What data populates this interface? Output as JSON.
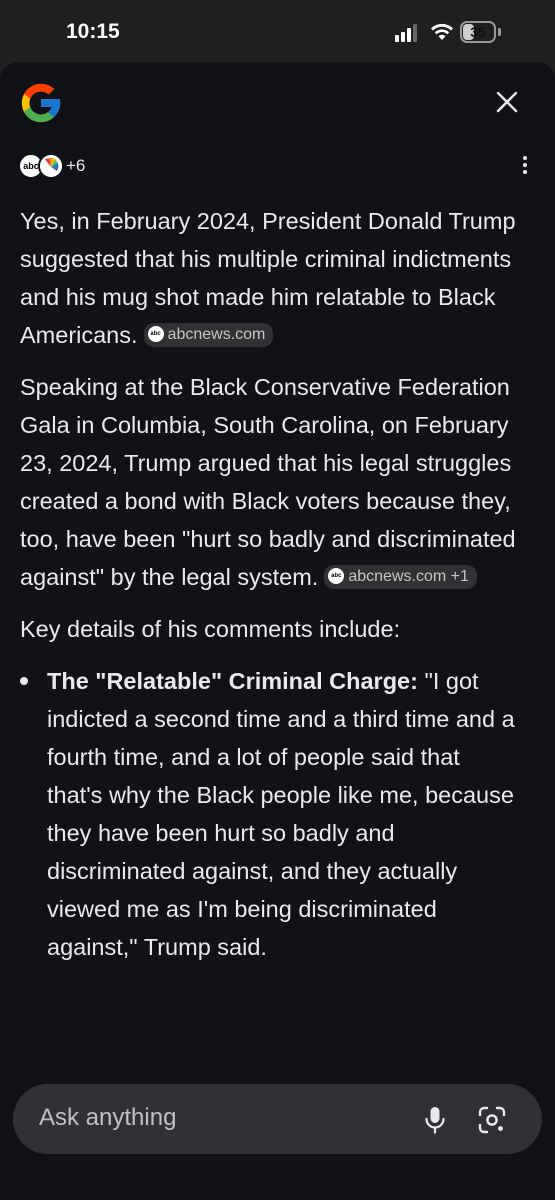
{
  "status_bar": {
    "time": "10:15",
    "battery_level": "35",
    "battery_fraction": 0.35
  },
  "header": {
    "logo_icon": "google-g-logo",
    "close_icon": "close-icon"
  },
  "sources": {
    "logos": [
      "abc-logo",
      "nbc-logo"
    ],
    "abc_text": "abc",
    "more_count": "+6",
    "menu_icon": "more-vert-icon"
  },
  "content": {
    "para1": "Yes, in February 2024, President Donald Trump suggested that his multiple criminal indictments and his mug shot made him relatable to Black Americans.",
    "para1_chip": "abcnews.com",
    "para2": "Speaking at the Black Conservative Federation Gala in Columbia, South Carolina, on February 23, 2024, Trump argued that his legal struggles created a bond with Black voters because they, too, have been \"hurt so badly and discriminated against\" by the legal system.",
    "para2_chip": "abcnews.com +1",
    "para3": "Key details of his comments include:",
    "bullets": [
      {
        "title": "The \"Relatable\" Criminal Charge:",
        "text": " \"I got indicted a second time and a third time and a fourth time, and a lot of people said that that's why the Black people like me, because they have been hurt so badly and discriminated against, and they actually viewed me as I'm being discriminated against,\" Trump said."
      }
    ]
  },
  "input": {
    "placeholder": "Ask anything",
    "mic_icon": "mic-icon",
    "lens_icon": "google-lens-icon"
  },
  "colors": {
    "background": "#111217",
    "text": "#e8eaed",
    "chip_bg": "#303134",
    "input_bg": "#303134"
  }
}
